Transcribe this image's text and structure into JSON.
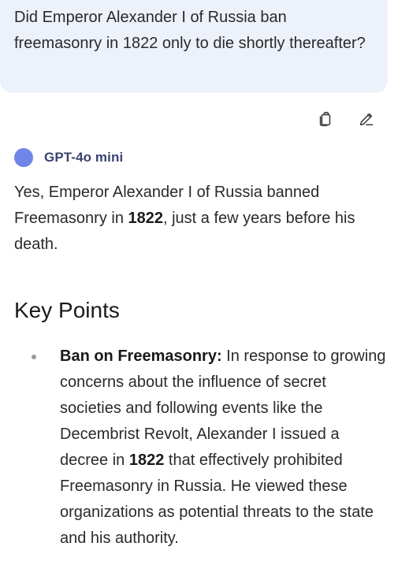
{
  "user_message": {
    "text": "Did Emperor Alexander I of Russia ban freemasonry in 1822 only to die shortly thereafter?"
  },
  "actions": {
    "copy_icon": "copy-icon",
    "edit_icon": "pencil-icon"
  },
  "assistant": {
    "model_name": "GPT-4o mini",
    "answer_before": "Yes, Emperor Alexander I of Russia banned Freemasonry in ",
    "answer_bold": "1822",
    "answer_after": ", just a few years before his death."
  },
  "key_points": {
    "heading": "Key Points",
    "items": [
      {
        "title": "Ban on Freemasonry:",
        "text_before": " In response to growing concerns about the influence of secret societies and following events like the Decembrist Revolt, Alexander I issued a decree in ",
        "bold": "1822",
        "text_after": " that effectively prohibited Freemasonry in Russia. He viewed these organizations as potential threats to the state and his authority."
      }
    ]
  },
  "colors": {
    "user_bubble": "#edf1fa",
    "model_dot": "#6f86e6",
    "model_name": "#3b4470"
  }
}
